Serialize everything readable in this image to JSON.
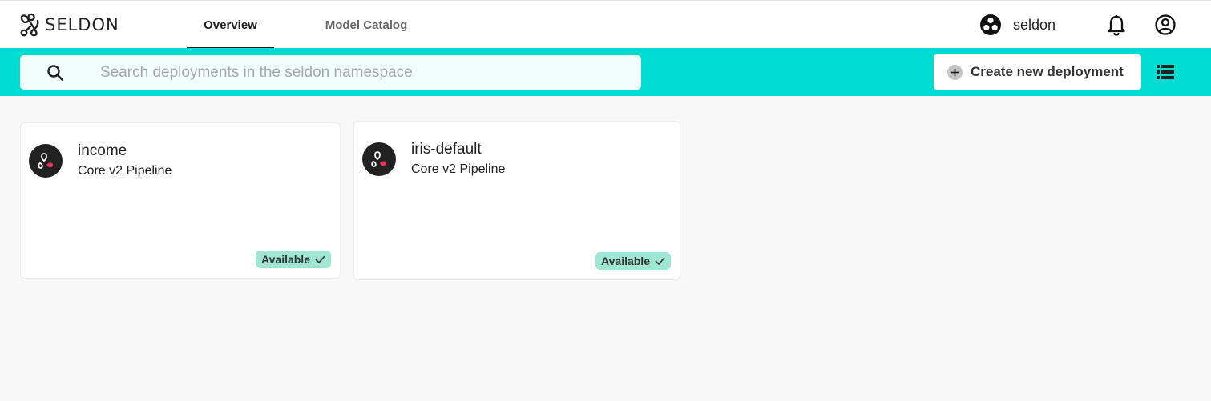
{
  "app": {
    "brand": "SELDON"
  },
  "nav": {
    "tabs": [
      {
        "label": "Overview",
        "active": true
      },
      {
        "label": "Model Catalog",
        "active": false
      }
    ],
    "namespace": "seldon",
    "icons": {
      "namespace": "namespace-icon",
      "notifications": "bell-icon",
      "account": "account-circle-icon"
    }
  },
  "toolbar": {
    "search_placeholder": "Search deployments in the seldon namespace",
    "search_value": "",
    "create_label": "Create new deployment",
    "view_toggle": "list-view-icon"
  },
  "colors": {
    "accent": "#00dcd0",
    "badge": "#a0e6d5",
    "avatar": "#212121",
    "avatar_accent": "#e8335a"
  },
  "deployments": [
    {
      "name": "income",
      "type": "Core v2 Pipeline",
      "status": "Available"
    },
    {
      "name": "iris-default",
      "type": "Core v2 Pipeline",
      "status": "Available"
    }
  ]
}
